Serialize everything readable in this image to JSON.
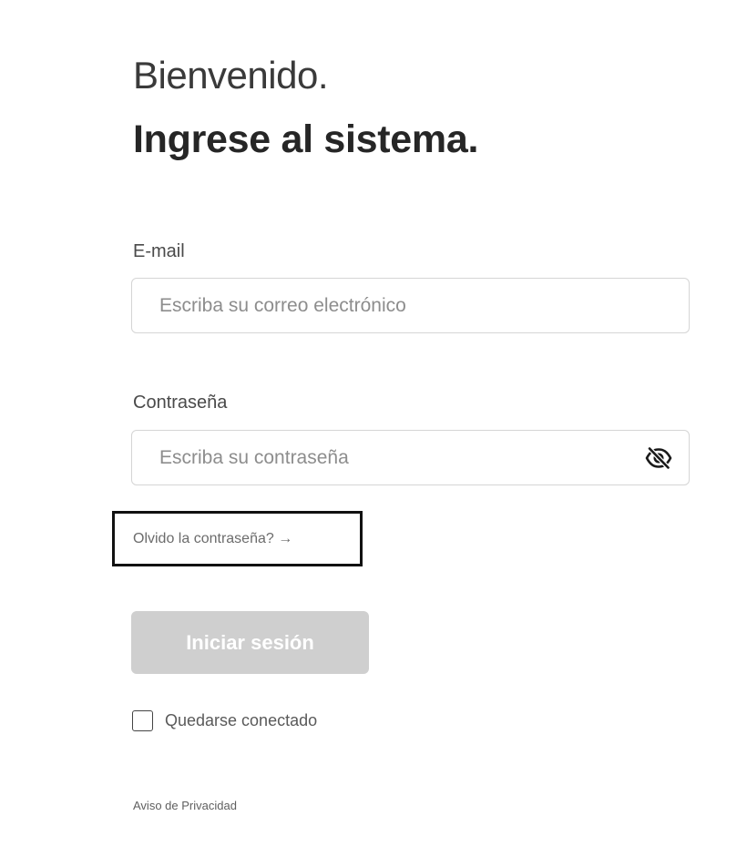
{
  "header": {
    "welcome": "Bienvenido.",
    "headline": "Ingrese al sistema."
  },
  "email": {
    "label": "E-mail",
    "placeholder": "Escriba su correo electrónico",
    "value": ""
  },
  "password": {
    "label": "Contraseña",
    "placeholder": "Escriba su contraseña",
    "value": "",
    "toggle_icon": "eye-slash-icon"
  },
  "forgot": {
    "label": "Olvido la contraseña? →"
  },
  "login": {
    "label": "Iniciar sesión",
    "enabled": false
  },
  "remember": {
    "label": "Quedarse conectado",
    "checked": false
  },
  "footer": {
    "privacy": "Aviso de Privacidad"
  },
  "colors": {
    "button_disabled_bg": "#cfcfcf",
    "input_border": "#d5d5d5",
    "text_dark": "#262626"
  }
}
